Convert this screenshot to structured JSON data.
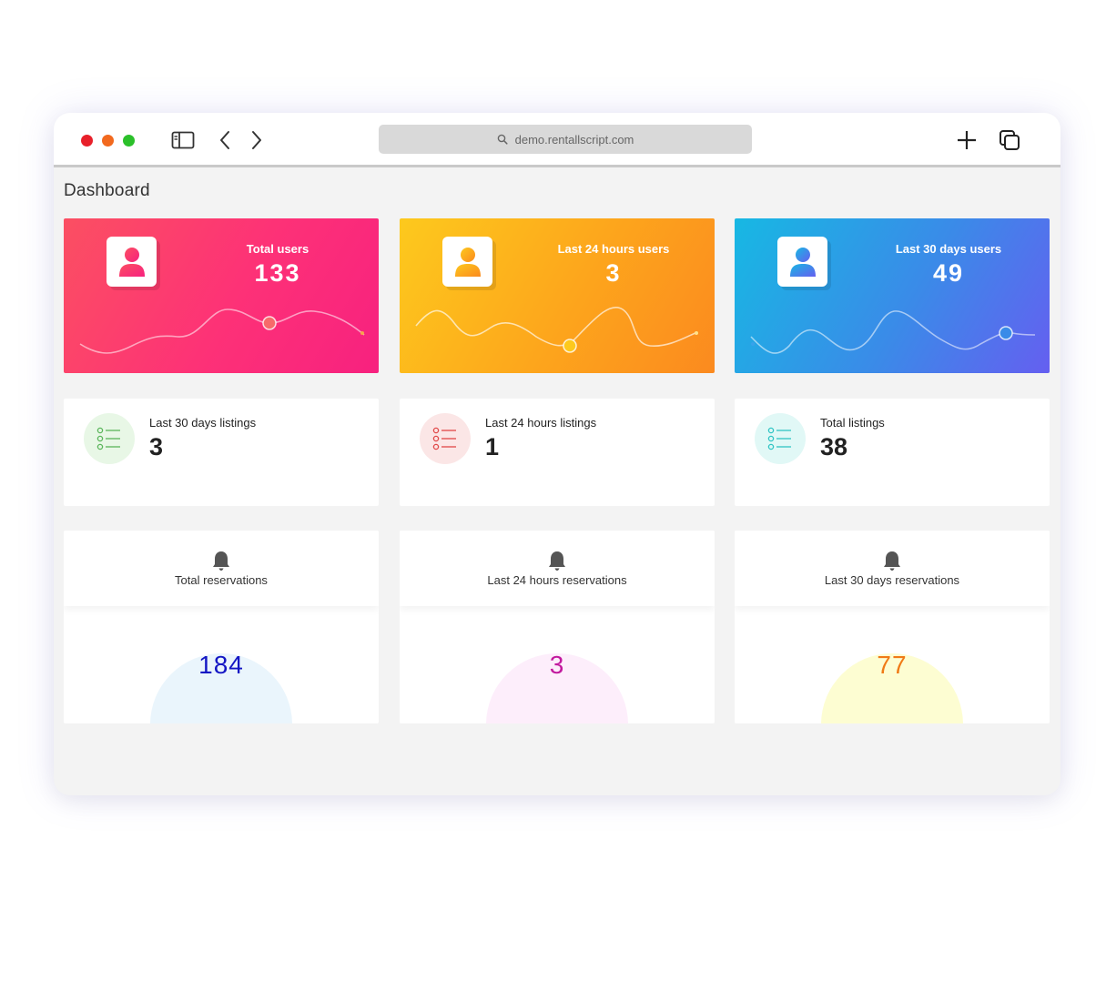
{
  "browser": {
    "url": "demo.rentallscript.com",
    "icons": [
      "sidebar-icon",
      "back-icon",
      "forward-icon",
      "search-icon",
      "new-tab-icon",
      "tabs-icon"
    ]
  },
  "page": {
    "title": "Dashboard"
  },
  "user_stats": [
    {
      "label": "Total users",
      "value": "133",
      "color": "#fd3177"
    },
    {
      "label": "Last 24 hours users",
      "value": "3",
      "color": "#fda51c"
    },
    {
      "label": "Last 30 days users",
      "value": "49",
      "color": "#3a8be8"
    }
  ],
  "listing_stats": [
    {
      "label": "Last 30 days listings",
      "value": "3",
      "accent": "#5ab55a",
      "bg": "#e8f7e6"
    },
    {
      "label": "Last 24 hours listings",
      "value": "1",
      "accent": "#e04848",
      "bg": "#fbe6e6"
    },
    {
      "label": "Total listings",
      "value": "38",
      "accent": "#2fc4c4",
      "bg": "#e1f8f6"
    }
  ],
  "reservation_stats": [
    {
      "label": "Total reservations",
      "value": "184",
      "color": "#1416c4",
      "circle": "#eaf5fc"
    },
    {
      "label": "Last 24 hours reservations",
      "value": "3",
      "color": "#c21a9e",
      "circle": "#fdeefb"
    },
    {
      "label": "Last 30 days reservations",
      "value": "77",
      "color": "#f07a16",
      "circle": "#fdfdd2"
    }
  ]
}
